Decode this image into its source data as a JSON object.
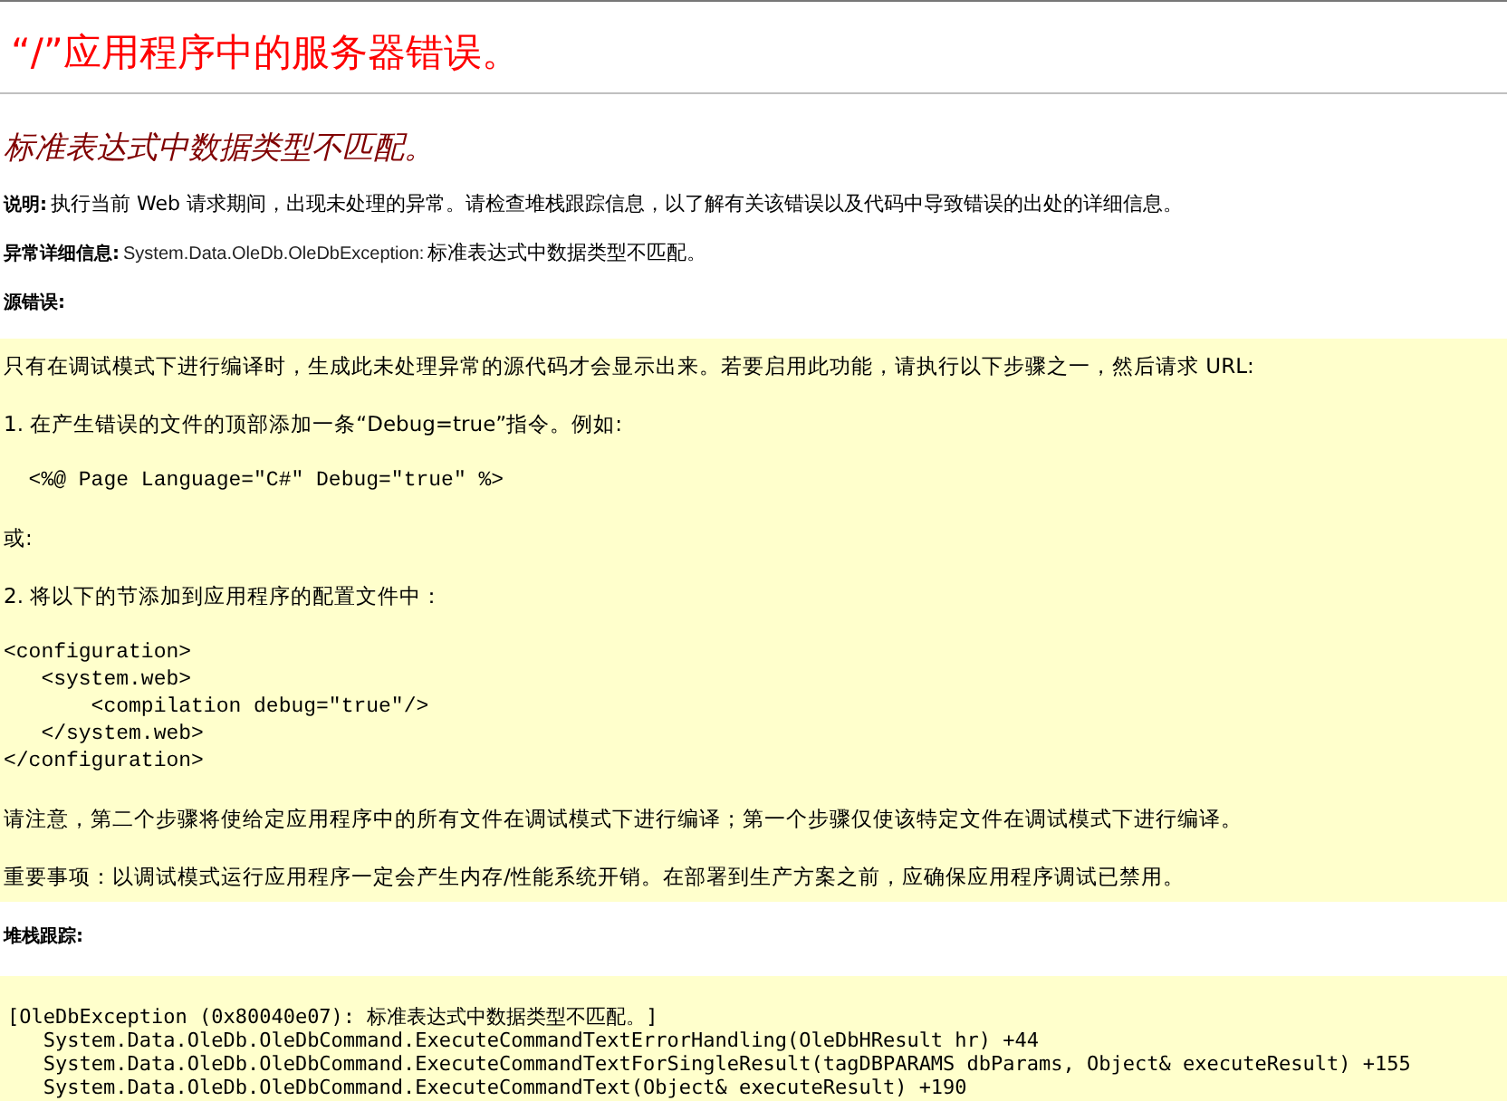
{
  "title": "“/”应用程序中的服务器错误。",
  "error_message": "标准表达式中数据类型不匹配。",
  "description": {
    "label": "说明:",
    "text": "执行当前 Web 请求期间，出现未处理的异常。请检查堆栈跟踪信息，以了解有关该错误以及代码中导致错误的出处的详细信息。"
  },
  "exception_details": {
    "label": "异常详细信息:",
    "type": "System.Data.OleDb.OleDbException:",
    "message": "标准表达式中数据类型不匹配。"
  },
  "source_error": {
    "label": "源错误:",
    "blocks": [
      {
        "kind": "text",
        "text": "只有在调试模式下进行编译时，生成此未处理异常的源代码才会显示出来。若要启用此功能，请执行以下步骤之一，然后请求 URL:"
      },
      {
        "kind": "text",
        "text": "1. 在产生错误的文件的顶部添加一条“Debug=true”指令。例如:"
      },
      {
        "kind": "code",
        "lines": [
          "  <%@ Page Language=\"C#\" Debug=\"true\" %>"
        ]
      },
      {
        "kind": "text",
        "text": "或:"
      },
      {
        "kind": "text",
        "text": "2. 将以下的节添加到应用程序的配置文件中："
      },
      {
        "kind": "code",
        "lines": [
          "<configuration>",
          "   <system.web>",
          "       <compilation debug=\"true\"/>",
          "   </system.web>",
          "</configuration>"
        ]
      },
      {
        "kind": "text",
        "text": "请注意，第二个步骤将使给定应用程序中的所有文件在调试模式下进行编译；第一个步骤仅使该特定文件在调试模式下进行编译。"
      },
      {
        "kind": "text",
        "text": "重要事项：以调试模式运行应用程序一定会产生内存/性能系统开销。在部署到生产方案之前，应确保应用程序调试已禁用。"
      }
    ]
  },
  "stack_trace": {
    "label": "堆栈跟踪:",
    "lines": [
      "[OleDbException (0x80040e07): 标准表达式中数据类型不匹配。]",
      "   System.Data.OleDb.OleDbCommand.ExecuteCommandTextErrorHandling(OleDbHResult hr) +44",
      "   System.Data.OleDb.OleDbCommand.ExecuteCommandTextForSingleResult(tagDBPARAMS dbParams, Object& executeResult) +155",
      "   System.Data.OleDb.OleDbCommand.ExecuteCommandText(Object& executeResult) +190"
    ]
  }
}
